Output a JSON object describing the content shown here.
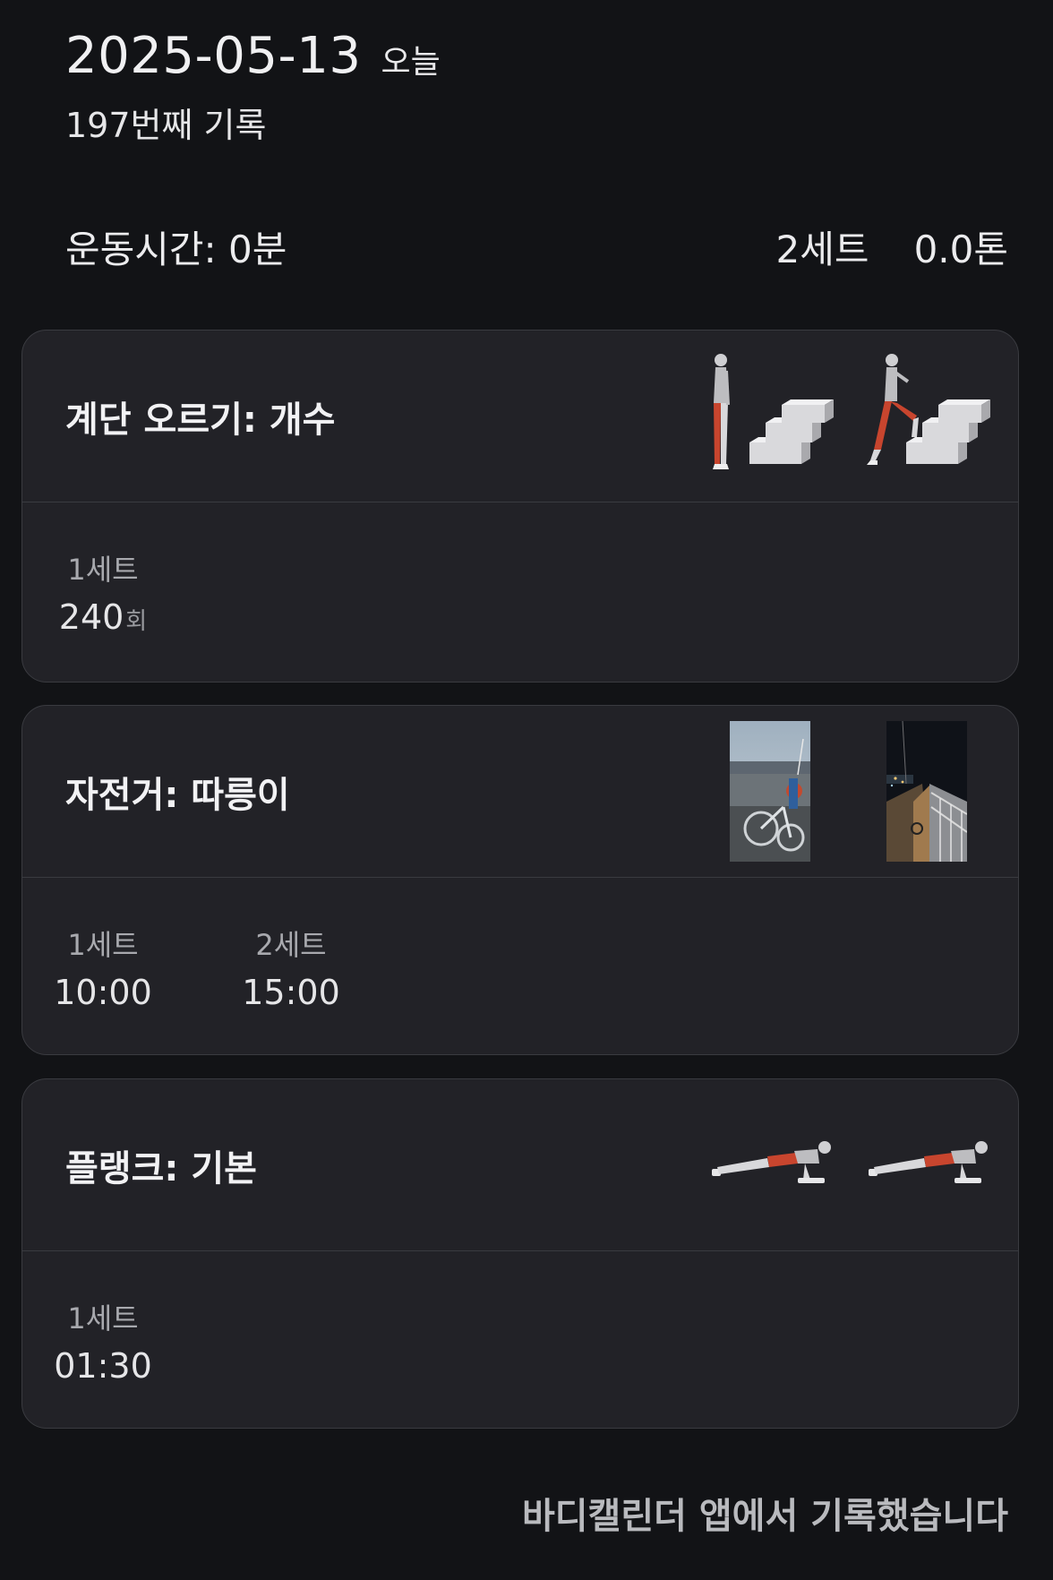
{
  "header": {
    "date": "2025-05-13",
    "today_label": "오늘",
    "record_count": "197번째 기록"
  },
  "summary": {
    "workout_time": "운동시간: 0분",
    "sets": "2세트",
    "weight": "0.0톤"
  },
  "cards": [
    {
      "title": "계단 오르기: 개수",
      "thumbnails": [
        "stair-climb-start-illustration",
        "stair-climb-step-illustration"
      ],
      "sets": [
        {
          "label": "1세트",
          "value": "240",
          "unit": "회"
        }
      ]
    },
    {
      "title": "자전거: 따릉이",
      "thumbnails": [
        "bike-rack-photo",
        "night-bridge-photo"
      ],
      "sets": [
        {
          "label": "1세트",
          "value": "10:00"
        },
        {
          "label": "2세트",
          "value": "15:00"
        }
      ]
    },
    {
      "title": "플랭크: 기본",
      "thumbnails": [
        "plank-illustration",
        "plank-illustration"
      ],
      "sets": [
        {
          "label": "1세트",
          "value": "01:30"
        }
      ]
    }
  ],
  "footer": "바디캘린더 앱에서 기록했습니다",
  "colors": {
    "background": "#121316",
    "card": "#222227",
    "border": "#3a3b40",
    "muscle_highlight": "#c8452e"
  }
}
